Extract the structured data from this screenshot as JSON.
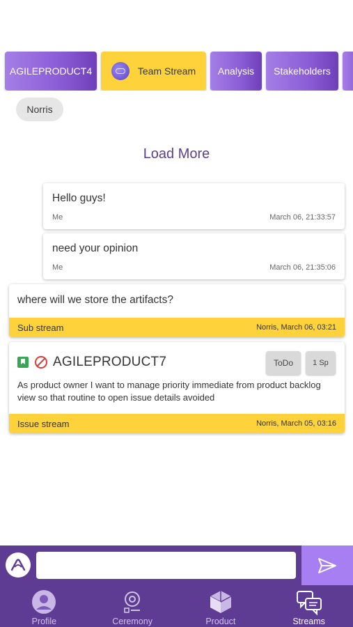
{
  "tabs": [
    {
      "label": "AGILEPRODUCT4",
      "active": false
    },
    {
      "label": "Team Stream",
      "active": true
    },
    {
      "label": "Analysis",
      "active": false
    },
    {
      "label": "Stakeholders",
      "active": false
    }
  ],
  "member_chip": "Norris",
  "load_more": "Load More",
  "messages": [
    {
      "text": "Hello guys!",
      "author": "Me",
      "time": "March 06, 21:33:57"
    },
    {
      "text": "need your opinion",
      "author": "Me",
      "time": "March 06, 21:35:06"
    }
  ],
  "sub_stream_card": {
    "text": "where will we store the artifacts?",
    "type": "Sub stream",
    "meta": "Norris,  March 06, 03:21"
  },
  "issue_card": {
    "title": "AGILEPRODUCT7",
    "status": "ToDo",
    "points": "1 Sp",
    "description": "As product owner I want to manage priority immediate from product backlog view so that routine to open issue details avoided",
    "type": "Issue stream",
    "meta": "Norris,  March 05, 03:16"
  },
  "composer": {
    "placeholder": "",
    "value": ""
  },
  "nav": [
    {
      "label": "Profile",
      "icon": "profile-icon",
      "active": false
    },
    {
      "label": "Ceremony",
      "icon": "ceremony-icon",
      "active": false
    },
    {
      "label": "Product",
      "icon": "product-box-icon",
      "active": false
    },
    {
      "label": "Streams",
      "icon": "streams-chat-icon",
      "active": true
    }
  ],
  "colors": {
    "accent_purple": "#5f3c94",
    "tab_gradient": "#8a5cd6",
    "highlight_yellow": "#fdd23a",
    "send_button": "#a77ff2"
  }
}
